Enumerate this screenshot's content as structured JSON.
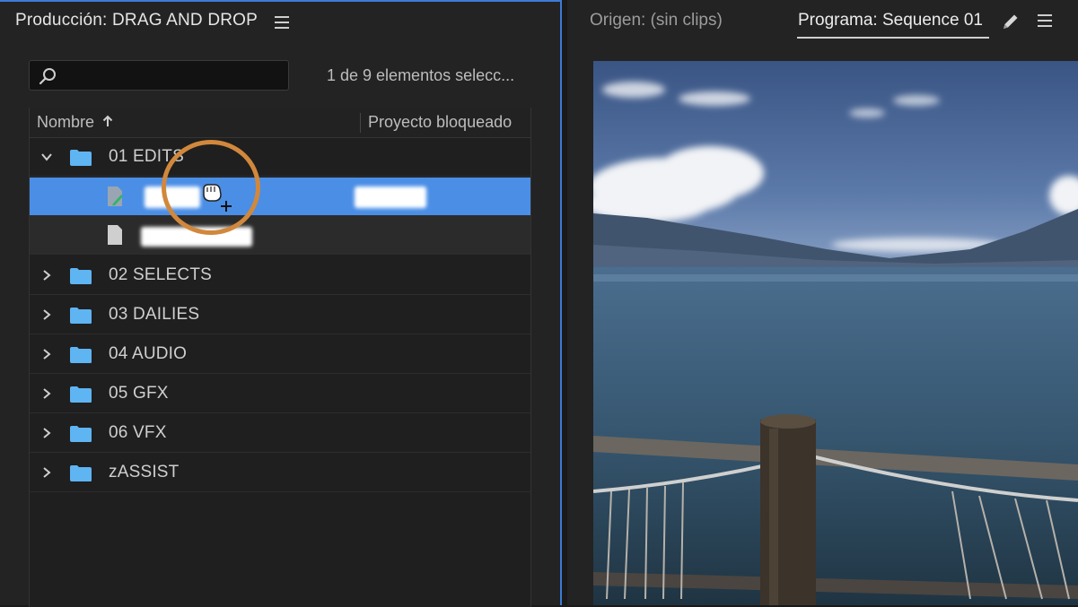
{
  "project_panel": {
    "title": "Producción: DRAG AND DROP",
    "search": {
      "value": "",
      "placeholder": ""
    },
    "selection_count": "1 de 9 elementos selecc...",
    "columns": {
      "name": "Nombre",
      "locked": "Proyecto bloqueado"
    },
    "folders": [
      {
        "label": "01 EDITS",
        "expanded": true
      },
      {
        "label": "02 SELECTS",
        "expanded": false
      },
      {
        "label": "03 DAILIES",
        "expanded": false
      },
      {
        "label": "04 AUDIO",
        "expanded": false
      },
      {
        "label": "05 GFX",
        "expanded": false
      },
      {
        "label": "06 VFX",
        "expanded": false
      },
      {
        "label": "zASSIST",
        "expanded": false
      }
    ],
    "colors": {
      "selection": "#4a8ee6",
      "folder": "#5fb4f2",
      "panel_focus": "#3d7bd6",
      "cursor_ring": "#d1883c"
    }
  },
  "monitor_panel": {
    "source_tab": "Origen: (sin clips)",
    "program_tab": "Programa: Sequence 01"
  },
  "icons": [
    "menu-icon",
    "search-icon",
    "sort-arrow-icon",
    "chevron-icon",
    "folder-icon",
    "sequence-file-icon",
    "file-icon",
    "grab-hand-cursor-icon",
    "pencil-icon"
  ]
}
